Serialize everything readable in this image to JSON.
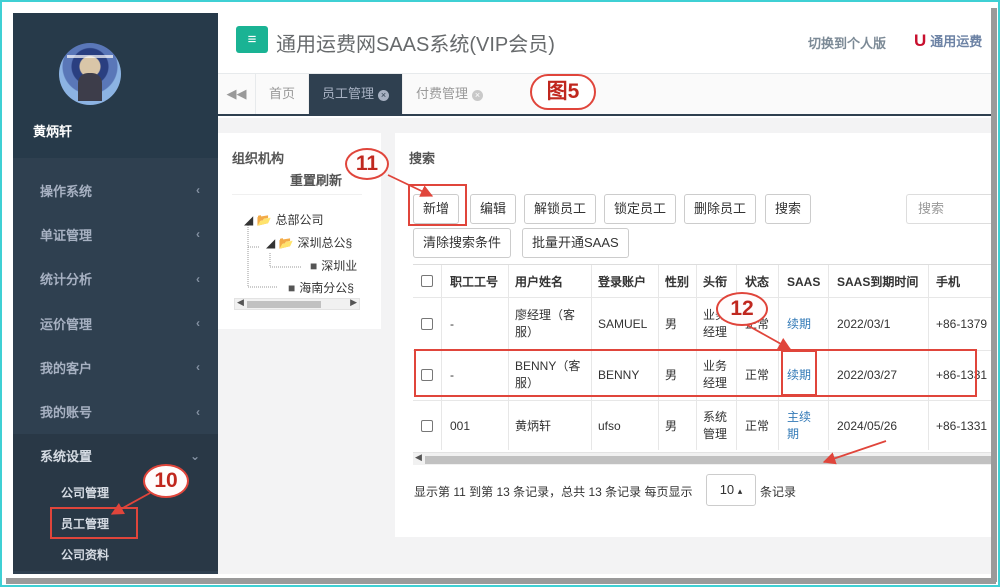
{
  "sidebar": {
    "user_name": "黄炳轩",
    "menu": [
      {
        "label": "操作系统"
      },
      {
        "label": "单证管理"
      },
      {
        "label": "统计分析"
      },
      {
        "label": "运价管理"
      },
      {
        "label": "我的客户"
      },
      {
        "label": "我的账号"
      },
      {
        "label": "系统设置"
      }
    ],
    "submenu": [
      "公司管理",
      "员工管理",
      "公司资料"
    ]
  },
  "header": {
    "menu_button_glyph": "≡",
    "title": "通用运费网SAAS系统(VIP会员)",
    "switch_label": "切换到个人版",
    "brand_initial": "U",
    "brand_text": "通用运费"
  },
  "tabs": {
    "back_glyph": "◀◀",
    "items": [
      {
        "label": "首页"
      },
      {
        "label": "员工管理",
        "close": "×"
      },
      {
        "label": "付费管理",
        "close": "×"
      }
    ]
  },
  "figure_label": "图5",
  "org": {
    "title": "组织机构",
    "reset": "重置刷新",
    "tree": [
      "总部公司",
      "深圳总公§",
      "深圳业",
      "海南分公§"
    ]
  },
  "search": {
    "title": "搜索",
    "placeholder": "搜索",
    "buttons_row1": [
      "新增",
      "编辑",
      "解锁员工",
      "锁定员工",
      "删除员工",
      "搜索"
    ],
    "buttons_row2": [
      "清除搜索条件",
      "批量开通SAAS"
    ]
  },
  "table": {
    "columns": [
      "职工工号",
      "用户姓名",
      "登录账户",
      "性别",
      "头衔",
      "状态",
      "SAAS",
      "SAAS到期时间",
      "手机"
    ],
    "rows": [
      {
        "id": "-",
        "name": "廖经理（客服）",
        "account": "SAMUEL",
        "gender": "男",
        "title": "业务经理",
        "status": "正常",
        "saas": "续期",
        "expire": "2022/03/1",
        "phone": "+86-1379"
      },
      {
        "id": "-",
        "name": "BENNY（客服）",
        "account": "BENNY",
        "gender": "男",
        "title": "业务经理",
        "status": "正常",
        "saas": "续期",
        "expire": "2022/03/27",
        "phone": "+86-1331"
      },
      {
        "id": "001",
        "name": "黄炳轩",
        "account": "ufso",
        "gender": "男",
        "title": "系统管理",
        "status": "正常",
        "saas": "主续期",
        "expire": "2024/05/26",
        "phone": "+86-1331"
      }
    ]
  },
  "pagination": {
    "info": "显示第 11 到第 13 条记录，总共 13 条记录 每页显示",
    "page_size": "10",
    "caret": "▴",
    "suffix": "条记录"
  },
  "annotations": {
    "step10": "10",
    "step11": "11",
    "step12": "12"
  },
  "colors": {
    "sidebar_bg": "#2f4050",
    "accent_green": "#1ab394",
    "annotation_red": "#e0453b",
    "link_blue": "#337ab7"
  },
  "icons": [
    "menu-icon",
    "double-chevron-left-icon",
    "close-icon",
    "folder-icon",
    "chevron-left-icon",
    "chevron-down-icon",
    "caret-up-icon"
  ]
}
